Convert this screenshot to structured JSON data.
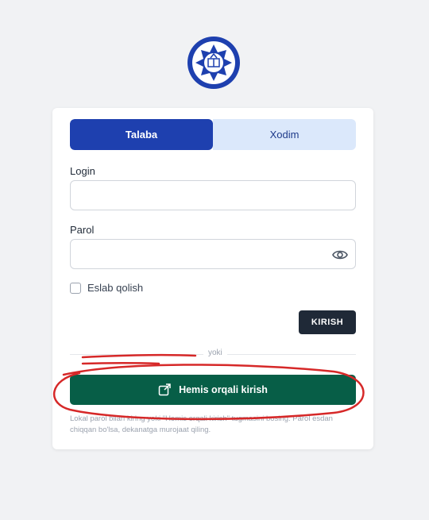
{
  "tabs": [
    {
      "label": "Talaba",
      "active": true
    },
    {
      "label": "Xodim",
      "active": false
    }
  ],
  "form": {
    "login_label": "Login",
    "login_value": "",
    "parol_label": "Parol",
    "parol_value": "",
    "remember_label": "Eslab qolish",
    "submit_label": "KIRISH"
  },
  "divider_text": "yoki",
  "hemis_button_label": "Hemis orqali kirish",
  "note": "Lokal parol bilan kiring yoki \"Hemis orqali kirish\" tugmasini bosing. Parol esdan chiqqan bo'lsa, dekanatga murojaat qiling.",
  "colors": {
    "accent": "#1e40af",
    "hemis": "#075e47",
    "annotation": "#d62828"
  },
  "icons": [
    "university-logo",
    "eye-icon",
    "external-link-icon"
  ]
}
